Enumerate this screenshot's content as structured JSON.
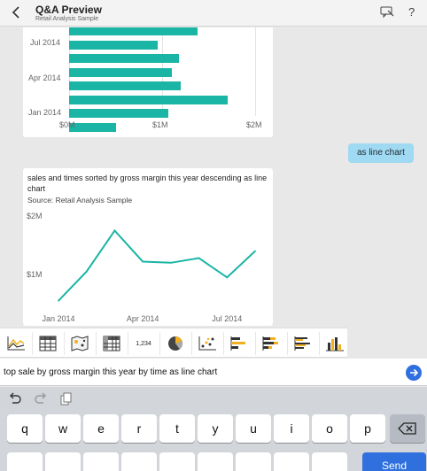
{
  "header": {
    "back_icon": "back-arrow-icon",
    "title": "Q&A Preview",
    "subtitle": "Retail Analysis Sample",
    "feedback_icon": "feedback-icon",
    "help_label": "?"
  },
  "bar_chart": {
    "y_tick_labels": [
      "Jul 2014",
      "Apr 2014",
      "Jan 2014"
    ],
    "x_tick_labels": [
      "$0M",
      "$1M",
      "$2M"
    ],
    "visible_bar_values_millions": [
      1.38,
      0.95,
      1.18,
      1.1,
      1.2,
      1.7,
      1.07,
      0.5
    ]
  },
  "user_message": "as line chart",
  "line_card": {
    "question": "sales and times sorted by gross margin this year descending as line chart",
    "source": "Source: Retail Analysis Sample"
  },
  "chart_data": {
    "type": "line",
    "x_tick_labels": [
      "Jan 2014",
      "Apr 2014",
      "Jul 2014"
    ],
    "y_tick_labels": [
      "$2M",
      "$1M"
    ],
    "x": [
      "Jan 2014",
      "Feb 2014",
      "Mar 2014",
      "Apr 2014",
      "May 2014",
      "Jun 2014",
      "Jul 2014",
      "Aug 2014"
    ],
    "values": [
      0.55,
      1.05,
      1.75,
      1.22,
      1.2,
      1.28,
      0.95,
      1.4
    ],
    "ylim": [
      0.5,
      2.0
    ],
    "series_color": "#1ab5a5"
  },
  "viz_types": [
    {
      "name": "line-chart-icon"
    },
    {
      "name": "table-icon"
    },
    {
      "name": "map-icon"
    },
    {
      "name": "matrix-icon"
    },
    {
      "name": "card-number-icon",
      "label": "1,234"
    },
    {
      "name": "pie-chart-icon"
    },
    {
      "name": "scatter-chart-icon"
    },
    {
      "name": "bar-chart-icon"
    },
    {
      "name": "stacked-bar-chart-icon"
    },
    {
      "name": "clustered-bar-chart-icon"
    },
    {
      "name": "column-chart-icon"
    }
  ],
  "query": {
    "value": "top sale by gross margin this year by time as line chart",
    "send_icon": "send-arrow-icon"
  },
  "keyboard": {
    "tools": [
      "undo-icon",
      "redo-icon",
      "paste-icon"
    ],
    "row1": [
      "q",
      "w",
      "e",
      "r",
      "t",
      "y",
      "u",
      "i",
      "o",
      "p"
    ],
    "delete_icon": "backspace-icon",
    "send_label": "Send"
  }
}
